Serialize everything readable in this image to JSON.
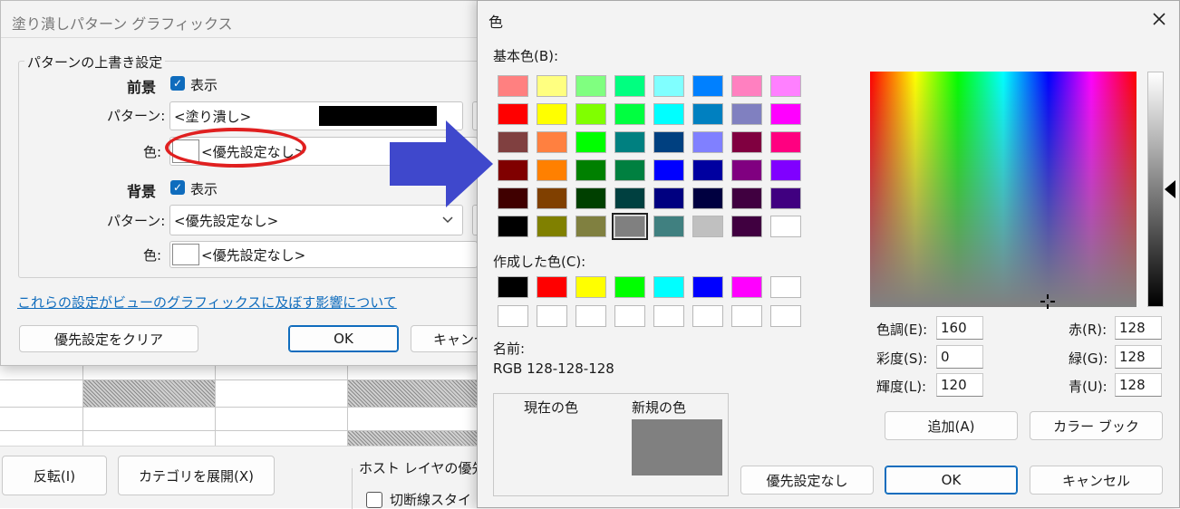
{
  "background": {
    "buttons": {
      "rotate": "反転(I)",
      "expand": "カテゴリを展開(X)"
    },
    "host_layer_label": "ホスト レイヤの優先",
    "cut_line_label": "切断線スタイ"
  },
  "fill_dialog": {
    "title": "塗り潰しパターン グラフィックス",
    "group_label": "パターンの上書き設定",
    "foreground": {
      "label": "前景",
      "show_label": "表示",
      "checked": true,
      "pattern_label": "パターン:",
      "pattern_value": "<塗り潰し>",
      "color_label": "色:",
      "color_value": "<優先設定なし>"
    },
    "background": {
      "label": "背景",
      "show_label": "表示",
      "checked": true,
      "pattern_label": "パターン:",
      "pattern_value": "<優先設定なし>",
      "color_label": "色:",
      "color_value": "<優先設定なし>"
    },
    "link_text": "これらの設定がビューのグラフィックスに及ぼす影響について",
    "clear_button": "優先設定をクリア",
    "ok_button": "OK",
    "cancel_button": "キャンセ"
  },
  "color_dialog": {
    "title": "色",
    "basic_label": "基本色(B):",
    "basic_colors": [
      "#ff8080",
      "#ffff80",
      "#80ff80",
      "#00ff80",
      "#80ffff",
      "#0080ff",
      "#ff80c0",
      "#ff80ff",
      "#ff0000",
      "#ffff00",
      "#80ff00",
      "#00ff40",
      "#00ffff",
      "#0080c0",
      "#8080c0",
      "#ff00ff",
      "#804040",
      "#ff8040",
      "#00ff00",
      "#008080",
      "#004080",
      "#8080ff",
      "#800040",
      "#ff0080",
      "#800000",
      "#ff8000",
      "#008000",
      "#008040",
      "#0000ff",
      "#0000a0",
      "#800080",
      "#8000ff",
      "#400000",
      "#804000",
      "#004000",
      "#004040",
      "#000080",
      "#000040",
      "#400040",
      "#400080",
      "#000000",
      "#808000",
      "#808040",
      "#808080",
      "#408080",
      "#c0c0c0",
      "#400040",
      "#ffffff"
    ],
    "selected_index": 43,
    "custom_label": "作成した色(C):",
    "custom_colors": [
      "#000000",
      "#ff0000",
      "#ffff00",
      "#00ff00",
      "#00ffff",
      "#0000ff",
      "#ff00ff",
      "#ffffff",
      "#ffffff",
      "#ffffff",
      "#ffffff",
      "#ffffff",
      "#ffffff",
      "#ffffff",
      "#ffffff",
      "#ffffff"
    ],
    "name_label": "名前:",
    "name_value": "RGB 128-128-128",
    "current_color_label": "現在の色",
    "new_color_label": "新規の色",
    "new_color": "#808080",
    "hue_label": "色調(E):",
    "hue": "160",
    "sat_label": "彩度(S):",
    "sat": "0",
    "lum_label": "輝度(L):",
    "lum": "120",
    "red_label": "赤(R):",
    "red": "128",
    "green_label": "緑(G):",
    "green": "128",
    "blue_label": "青(U):",
    "blue": "128",
    "add_button": "追加(A)",
    "colorbook_button": "カラー ブック",
    "no_override_button": "優先設定なし",
    "ok_button": "OK",
    "cancel_button": "キャンセル"
  },
  "annotation": {
    "ellipse_color": "#e02020",
    "arrow_color": "#3f48cc"
  }
}
